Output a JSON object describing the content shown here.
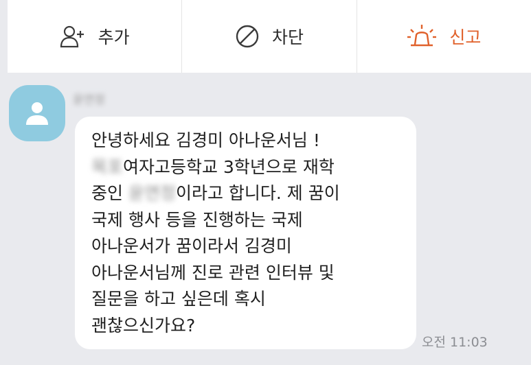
{
  "actions": {
    "add_label": "추가",
    "block_label": "차단",
    "report_label": "신고"
  },
  "colors": {
    "report": "#e0602a",
    "avatar": "#8fcbe0",
    "background": "#e9eaee"
  },
  "message": {
    "sender": "윤연정",
    "line1": "안녕하세요 김경미 아나운서님 !",
    "line2_school_blurred": "목포",
    "line2_rest": "여자고등학교 3학년으로 재학",
    "line3_prefix": "중인 ",
    "line3_name_blurred": "윤연정",
    "line3_rest": "이라고 합니다. 제 꿈이",
    "line4": "국제 행사 등을 진행하는 국제",
    "line5": "아나운서가 꿈이라서 김경미",
    "line6": "아나운서님께 진로 관련 인터뷰 및",
    "line7": "질문을 하고 싶은데 혹시",
    "line8": "괜찮으신가요?",
    "time": "오전 11:03"
  }
}
